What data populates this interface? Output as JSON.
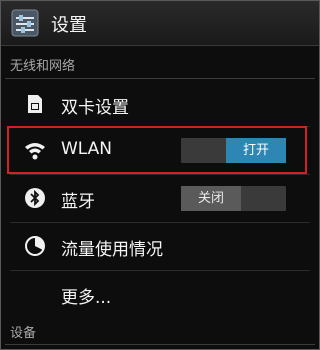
{
  "header": {
    "title": "设置",
    "icon": "settings-sliders-icon"
  },
  "sections": {
    "wireless": "无线和网络",
    "device": "设备"
  },
  "items": {
    "dual_sim": {
      "label": "双卡设置",
      "icon": "sim-card-icon"
    },
    "wlan": {
      "label": "WLAN",
      "icon": "wifi-icon",
      "toggle": "打开",
      "state": "on"
    },
    "bluetooth": {
      "label": "蓝牙",
      "icon": "bluetooth-icon",
      "toggle": "关闭",
      "state": "off"
    },
    "data_usage": {
      "label": "流量使用情况",
      "icon": "data-usage-icon"
    },
    "more": {
      "label": "更多..."
    }
  },
  "colors": {
    "accent": "#2d86b3",
    "highlight": "#d42020"
  }
}
